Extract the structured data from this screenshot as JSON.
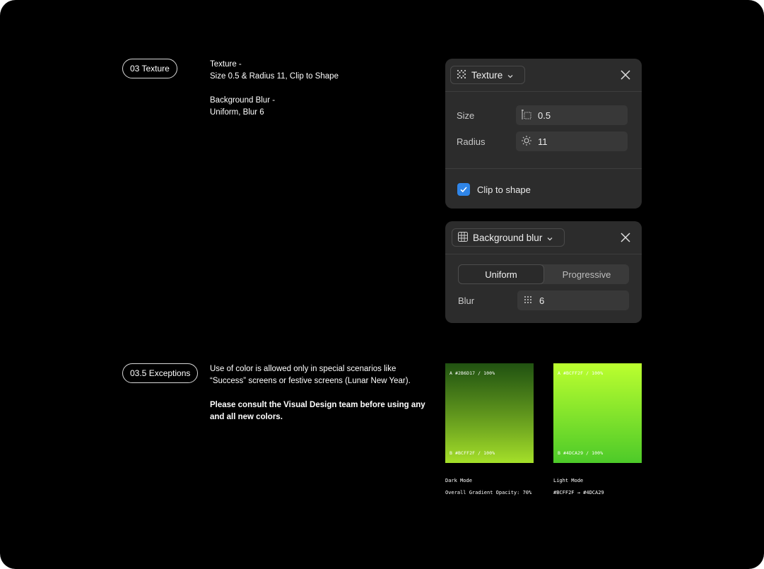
{
  "texture_section": {
    "tag": "03 Texture",
    "note": {
      "line1": "Texture -",
      "line2": "Size 0.5 & Radius 11, Clip to Shape",
      "line3": "Background Blur -",
      "line4": "Uniform, Blur 6"
    }
  },
  "texture_panel": {
    "dropdown_label": "Texture",
    "size_label": "Size",
    "size_value": "0.5",
    "radius_label": "Radius",
    "radius_value": "11",
    "clip_label": "Clip to shape",
    "clip_checked": true
  },
  "blur_panel": {
    "dropdown_label": "Background blur",
    "tabs": [
      "Uniform",
      "Progressive"
    ],
    "active_tab": "Uniform",
    "blur_label": "Blur",
    "blur_value": "6"
  },
  "exceptions_section": {
    "tag": "03.5 Exceptions",
    "note": {
      "line1": "Use of color is allowed only in special scenarios like",
      "line2": "“Success” screens or festive screens (Lunar New Year).",
      "line3": "Please consult the Visual Design team before using any",
      "line4": "and all new colors."
    }
  },
  "swatches": [
    {
      "top_label": "A #2B6D17 / 100%",
      "bottom_label": "B #BCFF2F / 100%",
      "color_a": "#2B6D17",
      "color_b": "#BCFF2F",
      "caption1": "Dark Mode",
      "caption2": "Overall Gradient Opacity: 70%"
    },
    {
      "top_label": "A #BCFF2F / 100%",
      "bottom_label": "B #4DCA29 / 100%",
      "color_a": "#BCFF2F",
      "color_b": "#4DCA29",
      "caption1": "Light Mode",
      "caption2": "#BCFF2F → #4DCA29"
    }
  ],
  "colors": {
    "accent_checkbox": "#2F85E8",
    "panel_bg": "#2C2C2C",
    "field_bg": "#383838"
  }
}
